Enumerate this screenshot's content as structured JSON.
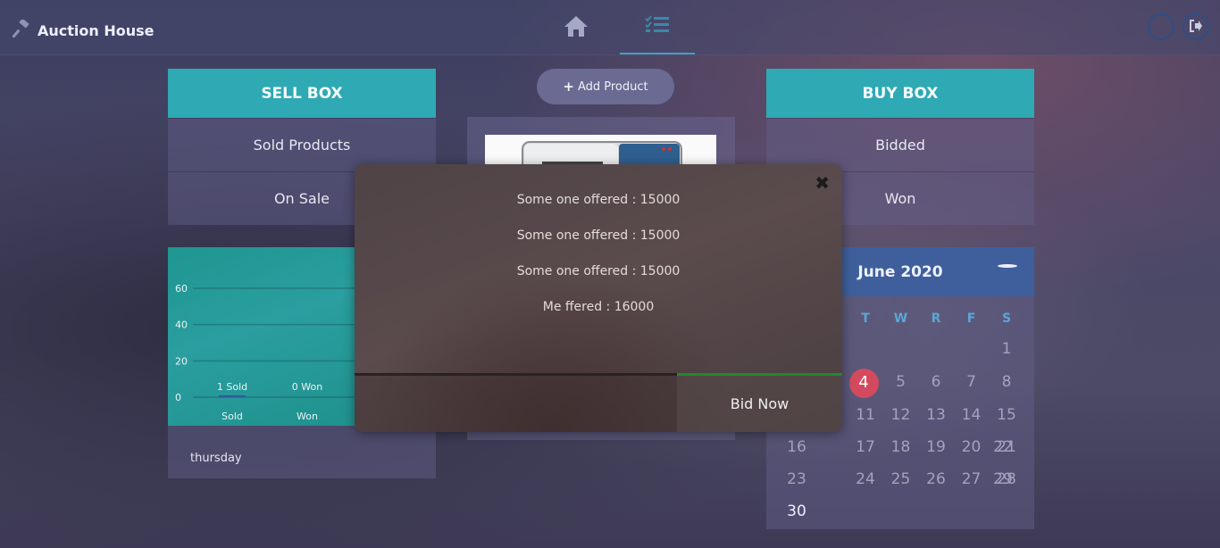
{
  "app": {
    "title": "Auction House"
  },
  "nav": {
    "tabs": [
      {
        "icon": "home-icon"
      },
      {
        "icon": "task-list-icon",
        "active": true
      }
    ]
  },
  "header_actions": [
    {
      "icon": "circle-icon"
    },
    {
      "icon": "logout-icon"
    }
  ],
  "sell_box": {
    "title": "SELL BOX",
    "items": [
      "Sold Products",
      "On Sale"
    ]
  },
  "buy_box": {
    "title": "BUY BOX",
    "items": [
      "Bidded",
      "Won"
    ]
  },
  "add_product": {
    "label": "Add Product"
  },
  "chart_data": {
    "type": "bar",
    "categories": [
      "Sold",
      "Won"
    ],
    "values": [
      1,
      0
    ],
    "data_labels": [
      "1 Sold",
      "0 Won"
    ],
    "yticks": [
      "60",
      "40",
      "20",
      "0"
    ],
    "ylim": [
      0,
      60
    ],
    "grid": true
  },
  "chart_footer": "thursday",
  "calendar": {
    "title": "June 2020",
    "dow": [
      "T",
      "W",
      "R",
      "F",
      "S"
    ],
    "today": "4",
    "days": [
      {
        "d": "1",
        "col": 4,
        "row": 0
      },
      {
        "d": "4",
        "col": 0,
        "row": 1
      },
      {
        "d": "5",
        "col": 1,
        "row": 1
      },
      {
        "d": "6",
        "col": 2,
        "row": 1
      },
      {
        "d": "7",
        "col": 3,
        "row": 1
      },
      {
        "d": "8",
        "col": 4,
        "row": 1
      },
      {
        "d": "11",
        "col": 0,
        "row": 2
      },
      {
        "d": "12",
        "col": 1,
        "row": 2
      },
      {
        "d": "13",
        "col": 2,
        "row": 2
      },
      {
        "d": "14",
        "col": 3,
        "row": 2
      },
      {
        "d": "15",
        "col": 4,
        "row": 2
      },
      {
        "d": "16",
        "col": -1,
        "row": 3
      },
      {
        "d": "17",
        "col": 0,
        "row": 3
      },
      {
        "d": "18",
        "col": 1,
        "row": 3
      },
      {
        "d": "19",
        "col": 2,
        "row": 3
      },
      {
        "d": "20",
        "col": 3,
        "row": 3
      },
      {
        "d": "21",
        "col": 4,
        "row": 3
      },
      {
        "d": "22",
        "col": 5,
        "row": 3
      },
      {
        "d": "23",
        "col": -1,
        "row": 4
      },
      {
        "d": "24",
        "col": 0,
        "row": 4
      },
      {
        "d": "25",
        "col": 1,
        "row": 4
      },
      {
        "d": "26",
        "col": 2,
        "row": 4
      },
      {
        "d": "27",
        "col": 3,
        "row": 4
      },
      {
        "d": "28",
        "col": 4,
        "row": 4
      },
      {
        "d": "29",
        "col": 5,
        "row": 4
      },
      {
        "d": "30",
        "col": -1,
        "row": 5
      }
    ]
  },
  "modal": {
    "offers": [
      "Some one offered : 15000",
      "Some one offered : 15000",
      "Some one offered : 15000",
      "Me ffered : 16000"
    ],
    "bid_input_value": "",
    "bid_button": "Bid Now"
  }
}
